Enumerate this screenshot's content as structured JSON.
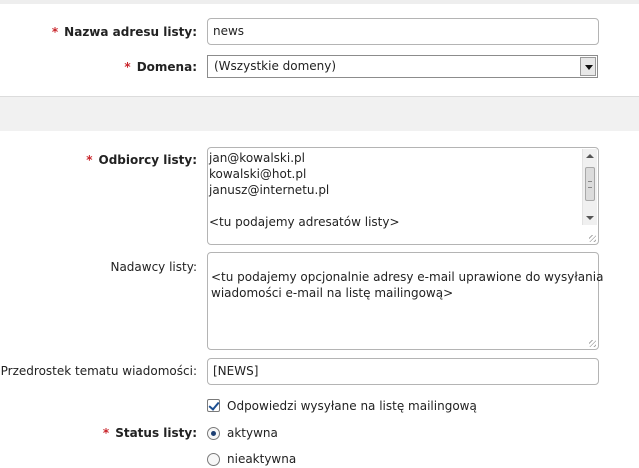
{
  "list_form": {
    "required_mark": "*",
    "list_address": {
      "label": "Nazwa adresu listy:",
      "value": "news"
    },
    "domain": {
      "label": "Domena:",
      "selected": "(Wszystkie domeny)"
    },
    "recipients": {
      "label": "Odbiorcy listy:",
      "lines": [
        "jan@kowalski.pl",
        "kowalski@hot.pl",
        "janusz@internetu.pl",
        "",
        "<tu podajemy adresatów listy>"
      ]
    },
    "senders": {
      "label": "Nadawcy listy:",
      "lines": [
        "<tu podajemy opcjonalnie adresy e-mail uprawione do wysyłania",
        "wiadomości e-mail na listę mailingową>"
      ]
    },
    "subject_prefix": {
      "label": "Przedrostek tematu wiadomości:",
      "value": "[NEWS]"
    },
    "replies_to_list": {
      "label": "Odpowiedzi wysyłane na listę mailingową",
      "checked": true
    },
    "status": {
      "label": "Status listy:",
      "options": [
        {
          "label": "aktywna",
          "checked": true
        },
        {
          "label": "nieaktywna",
          "checked": false
        }
      ]
    }
  },
  "colors": {
    "required": "#c9252b",
    "band": "#f1f1f1",
    "border": "#b4b4b4"
  }
}
